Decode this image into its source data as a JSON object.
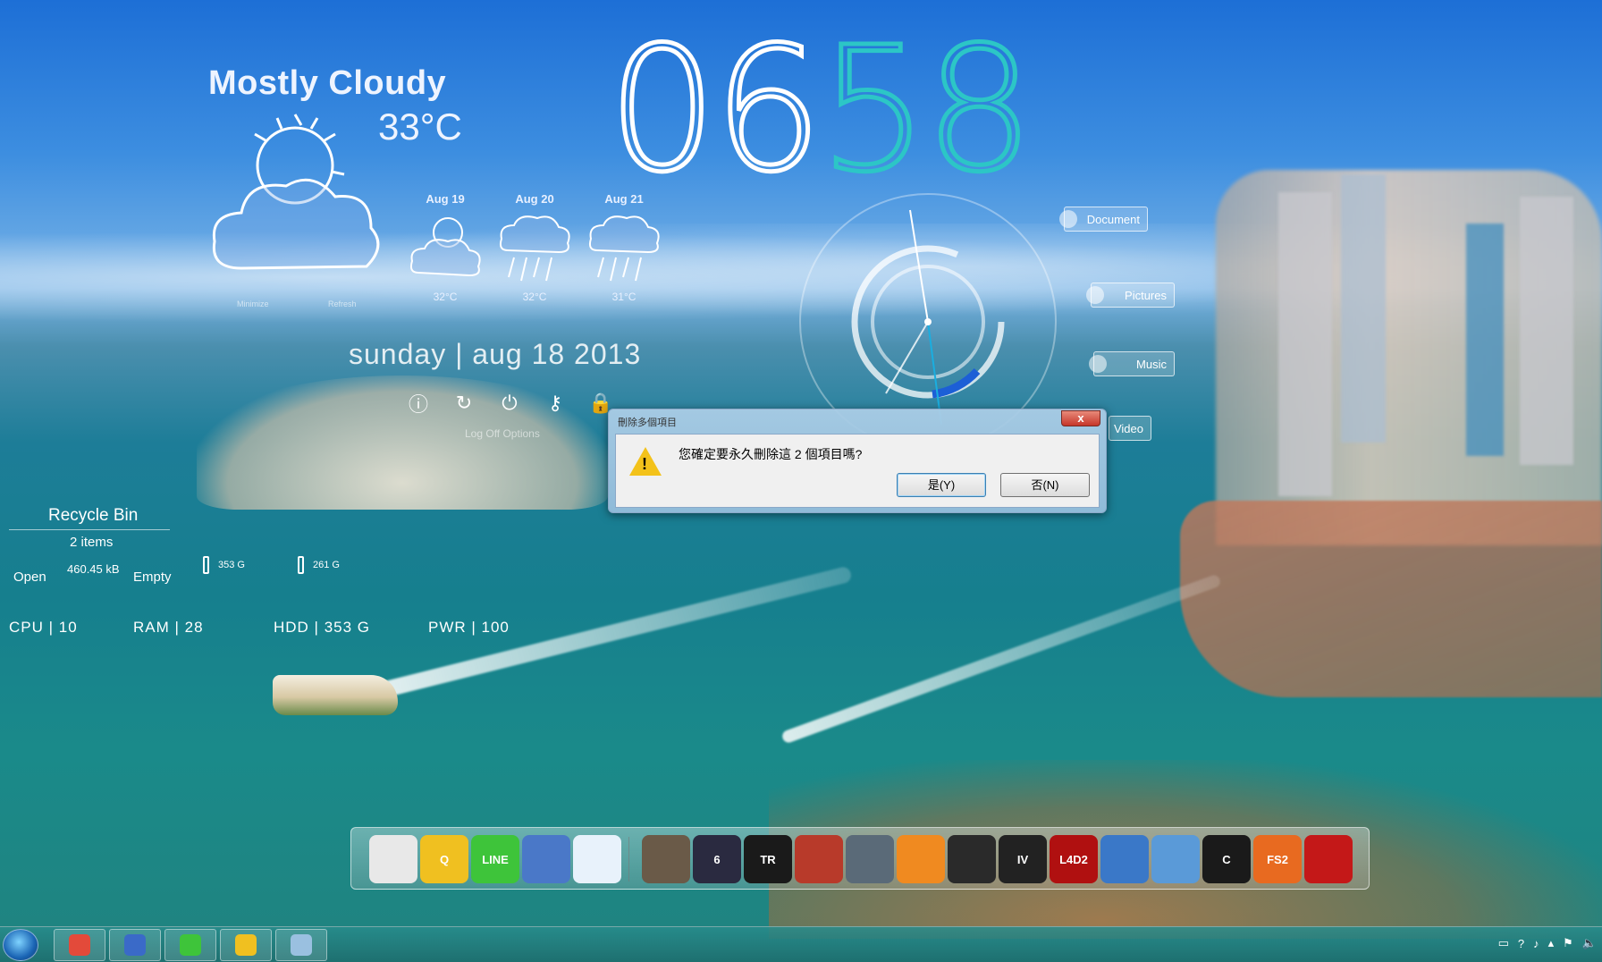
{
  "weather": {
    "condition": "Mostly Cloudy",
    "temperature": "33°C",
    "minimize_label": "Minimize",
    "refresh_label": "Refresh",
    "forecast": [
      {
        "date": "Aug 19",
        "temp": "32°C"
      },
      {
        "date": "Aug 20",
        "temp": "32°C"
      },
      {
        "date": "Aug 21",
        "temp": "31°C"
      }
    ]
  },
  "date_line": "sunday | aug 18 2013",
  "power": {
    "logoff_label": "Log Off Options"
  },
  "clock": {
    "hours": "06",
    "minutes": "58"
  },
  "shortcuts": {
    "document": "Document",
    "pictures": "Pictures",
    "music": "Music",
    "video": "Video"
  },
  "recycle_bin": {
    "title": "Recycle Bin",
    "items": "2 items",
    "open": "Open",
    "size": "460.45 kB",
    "empty": "Empty"
  },
  "drives": [
    {
      "size": "353 G"
    },
    {
      "size": "261 G"
    }
  ],
  "stats": {
    "cpu": "CPU  |  10",
    "ram": "RAM  |  28",
    "hdd": "HDD  |  353 G",
    "pwr": "PWR  |  100"
  },
  "dialog": {
    "title": "刪除多個項目",
    "close": "x",
    "message": "您確定要永久刪除這 2 個項目嗎?",
    "yes": "是(Y)",
    "no": "否(N)",
    "warning_icon": "warning-icon"
  },
  "dock_apps": [
    {
      "name": "chrome",
      "label": "",
      "color": "#e8e8e8"
    },
    {
      "name": "q-app",
      "label": "Q",
      "color": "#f0c020"
    },
    {
      "name": "line",
      "label": "LINE",
      "color": "#3ec43a"
    },
    {
      "name": "app-blue",
      "label": "",
      "color": "#4a78c8"
    },
    {
      "name": "dropbox",
      "label": "",
      "color": "#e8f2fb"
    },
    {
      "name": "assassins-creed",
      "label": "",
      "color": "#6a5a48"
    },
    {
      "name": "resident-evil",
      "label": "6",
      "color": "#2a2a40"
    },
    {
      "name": "tomb-raider",
      "label": "TR",
      "color": "#1a1a1a"
    },
    {
      "name": "racing",
      "label": "",
      "color": "#b83a2a"
    },
    {
      "name": "battlefield",
      "label": "",
      "color": "#5a6a78"
    },
    {
      "name": "orange-ring",
      "label": "",
      "color": "#f08a20"
    },
    {
      "name": "skyrim",
      "label": "",
      "color": "#2a2a2a"
    },
    {
      "name": "gta-iv",
      "label": "IV",
      "color": "#222"
    },
    {
      "name": "l4d2",
      "label": "L4D2",
      "color": "#b01010"
    },
    {
      "name": "nba",
      "label": "",
      "color": "#3a78c8"
    },
    {
      "name": "blue-gear",
      "label": "",
      "color": "#5a9ad8"
    },
    {
      "name": "cyberlink",
      "label": "C",
      "color": "#1a1a1a"
    },
    {
      "name": "fs2",
      "label": "FS2",
      "color": "#e86a20"
    },
    {
      "name": "red-figure",
      "label": "",
      "color": "#c41818"
    }
  ],
  "taskbar": [
    {
      "name": "chrome",
      "color": "#e34a3a"
    },
    {
      "name": "app-blue",
      "color": "#3a6ac8"
    },
    {
      "name": "line",
      "color": "#3ec43a"
    },
    {
      "name": "q-app",
      "color": "#f0c020"
    },
    {
      "name": "drop",
      "color": "#9ac0e0"
    }
  ]
}
